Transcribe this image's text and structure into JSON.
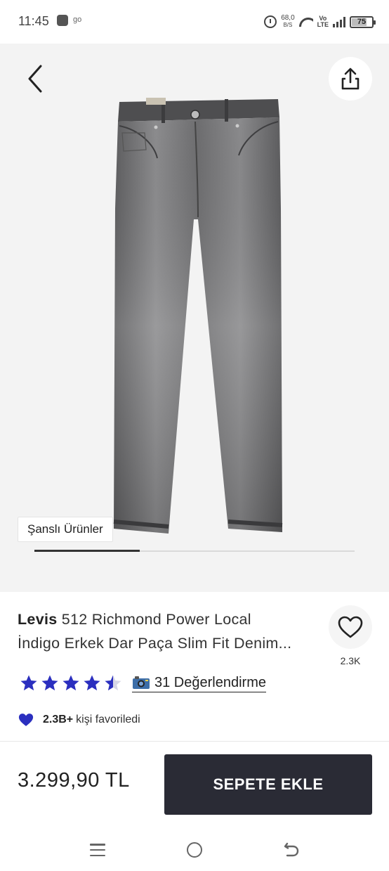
{
  "status_bar": {
    "time": "11:45",
    "app_text": "go",
    "net_speed_value": "68,0",
    "net_speed_unit": "B/S",
    "volte_top": "Vo",
    "volte_bottom": "LTE",
    "battery_percent": "75",
    "battery_level": 0.75,
    "icons": [
      "app-notification-icon",
      "alarm-icon",
      "wifi-icon",
      "signal-icon",
      "battery-icon"
    ]
  },
  "image_area": {
    "background": "#f3f3f3",
    "back_icon": "chevron-left-icon",
    "share_icon": "share-icon",
    "product_image": "grey-slim-fit-jeans",
    "badge": "Şanslı Ürünler",
    "carousel_progress": 0.33
  },
  "product": {
    "brand": "Levis",
    "title_line1": "512 Richmond Power Local",
    "title_line2": "İndigo Erkek Dar Paça Slim Fit Denim...",
    "favorite_icon": "heart-outline-icon",
    "favorite_count": "2.3K",
    "rating": 4.5,
    "star_color": "#2b2fbf",
    "review_camera_icon": "camera-icon",
    "review_text": "31 Değerlendirme",
    "fav_heart_icon": "heart-filled-icon",
    "fav_heart_color": "#2b2fbf",
    "favorited_count": "2.3B+",
    "favorited_text": "kişi favoriledi"
  },
  "cart_bar": {
    "price": "3.299,90 TL",
    "add_to_cart": "SEPETE EKLE",
    "button_color": "#2a2b35"
  },
  "nav_bar": {
    "icons": [
      "recent-apps-icon",
      "home-icon",
      "back-icon"
    ]
  }
}
